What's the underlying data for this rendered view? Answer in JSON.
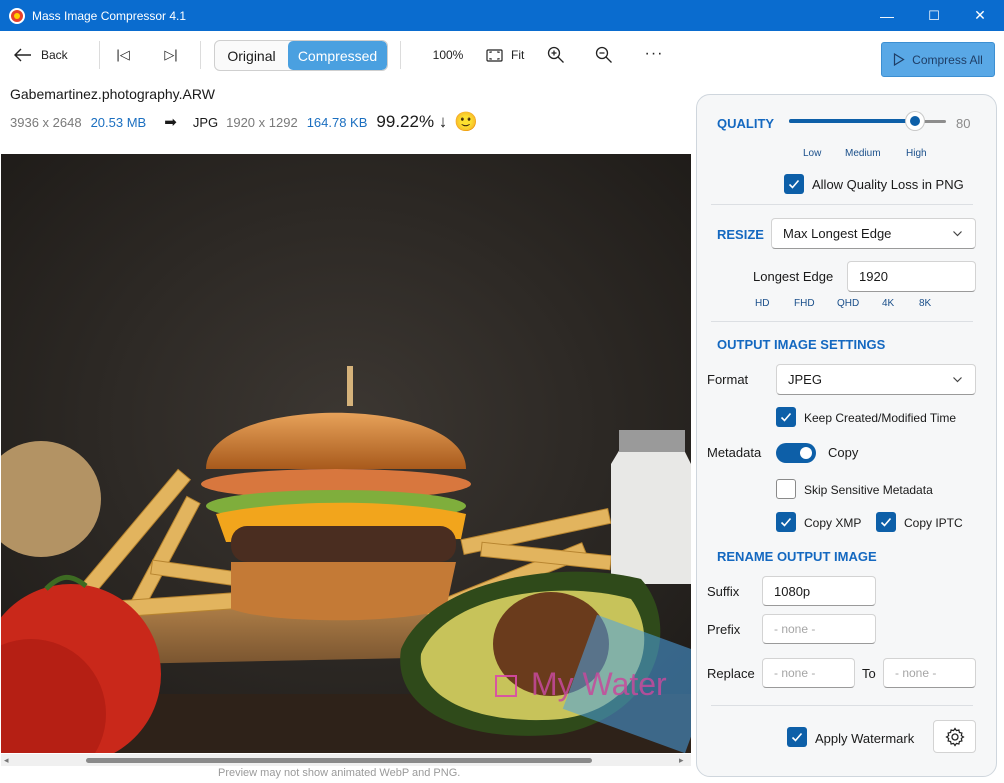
{
  "window": {
    "title": "Mass Image Compressor 4.1",
    "minimize": "—",
    "maximize": "☐",
    "close": "✕"
  },
  "toolbar": {
    "back_label": "Back",
    "first_glyph": "|◁",
    "next_glyph": "▷|",
    "view_original": "Original",
    "view_compressed": "Compressed",
    "zoom_level": "100%",
    "fit_label": "Fit",
    "more_glyph": "···",
    "compress_all": "Compress All",
    "active_view": "Compressed"
  },
  "file": {
    "name": "Gabemartinez.photography.ARW",
    "orig_dims": "3936 x 2648",
    "orig_size": "20.53 MB",
    "arrow": "➡",
    "format": "JPG",
    "new_dims": "1920 x 1292",
    "new_size": "164.78 KB",
    "reduction": "99.22% ↓",
    "emoji": "🙂"
  },
  "preview": {
    "note": "Preview may not show animated WebP and PNG.",
    "watermark_text": "My Water"
  },
  "quality": {
    "title": "QUALITY",
    "value": "80",
    "value_fraction": 0.8,
    "labels": {
      "low": "Low",
      "medium": "Medium",
      "high": "High"
    },
    "allow_png_loss": "Allow Quality Loss in PNG"
  },
  "resize": {
    "title": "RESIZE",
    "mode": "Max Longest Edge",
    "edge_label": "Longest Edge",
    "edge_value": "1920",
    "presets": [
      "HD",
      "FHD",
      "QHD",
      "4K",
      "8K"
    ]
  },
  "output": {
    "title": "OUTPUT IMAGE SETTINGS",
    "format_label": "Format",
    "format_value": "JPEG",
    "keep_time": "Keep Created/Modified Time",
    "metadata_label": "Metadata",
    "metadata_value": "Copy",
    "skip_sensitive": "Skip Sensitive Metadata",
    "copy_xmp": "Copy XMP",
    "copy_iptc": "Copy IPTC"
  },
  "rename": {
    "title": "RENAME OUTPUT IMAGE",
    "suffix_label": "Suffix",
    "suffix_value": "1080p",
    "prefix_label": "Prefix",
    "prefix_placeholder": "- none -",
    "replace_label": "Replace",
    "replace_placeholder": "- none -",
    "to_label": "To",
    "to_placeholder": "- none -"
  },
  "watermark": {
    "apply_label": "Apply Watermark"
  },
  "colors": {
    "titlebar": "#0a6ccf",
    "accent": "#0d5fa8",
    "section_title": "#1468c0"
  }
}
